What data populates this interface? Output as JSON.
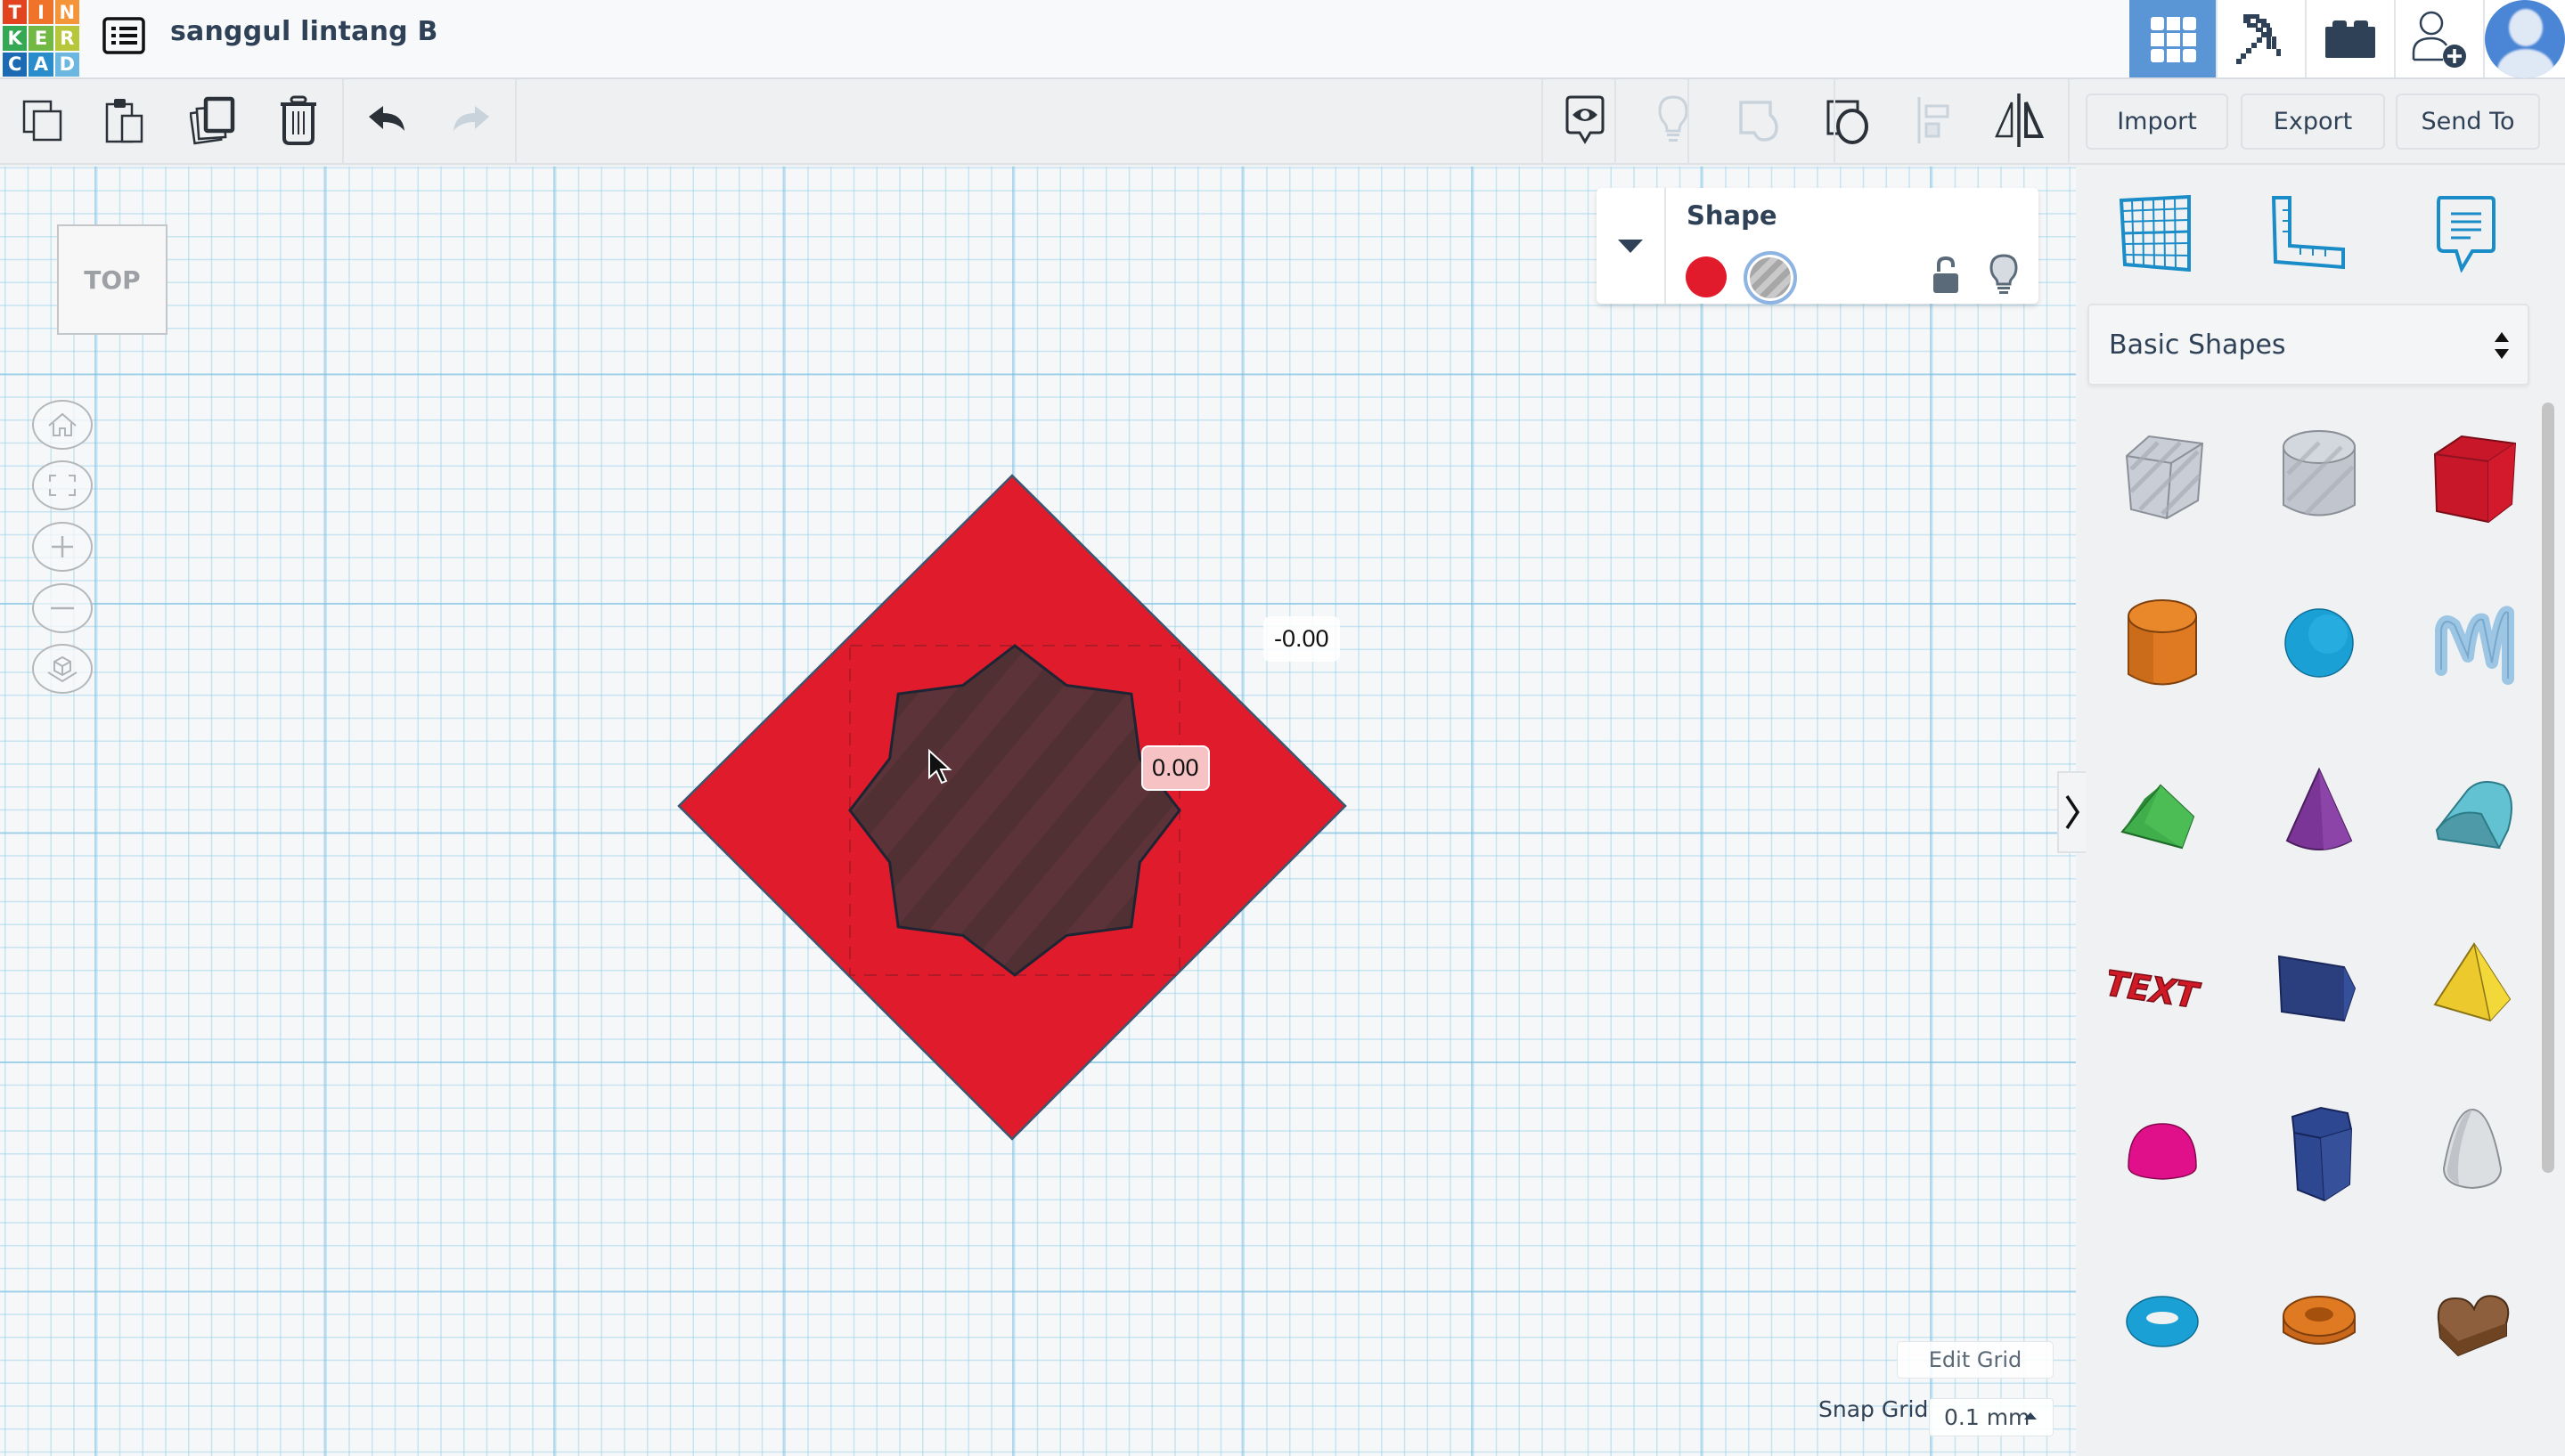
{
  "app": {
    "logo_letters": [
      "T",
      "I",
      "N",
      "K",
      "E",
      "R",
      "C",
      "A",
      "D"
    ],
    "logo_colors": [
      "#e1441f",
      "#f0732a",
      "#f5953a",
      "#34a853",
      "#72b844",
      "#b7c63a",
      "#1b6ab3",
      "#2a8ccb",
      "#6bb7e0"
    ],
    "design_title": "sanggul lintang B"
  },
  "topnav": {
    "items": [
      {
        "name": "3d-design-view",
        "icon": "grid-icon",
        "active": true
      },
      {
        "name": "blocks-view",
        "icon": "pickaxe-icon",
        "active": false
      },
      {
        "name": "bricks-view",
        "icon": "brick-icon",
        "active": false
      },
      {
        "name": "invite-user",
        "icon": "user-add-icon",
        "active": false
      },
      {
        "name": "profile",
        "icon": "avatar-icon",
        "active": false
      }
    ]
  },
  "toolbar": {
    "left": [
      {
        "name": "copy",
        "icon": "copy-icon",
        "enabled": true
      },
      {
        "name": "paste",
        "icon": "paste-icon",
        "enabled": true
      },
      {
        "name": "duplicate",
        "icon": "duplicate-icon",
        "enabled": true
      },
      {
        "name": "delete",
        "icon": "trash-icon",
        "enabled": true
      },
      {
        "name": "undo",
        "icon": "undo-icon",
        "enabled": true
      },
      {
        "name": "redo",
        "icon": "redo-icon",
        "enabled": false
      }
    ],
    "right": [
      {
        "name": "notes",
        "icon": "eye-bubble-icon",
        "enabled": true
      },
      {
        "name": "show-all",
        "icon": "lightbulb-icon",
        "enabled": false
      },
      {
        "name": "group",
        "icon": "group-icon",
        "enabled": false
      },
      {
        "name": "ungroup",
        "icon": "ungroup-icon",
        "enabled": true
      },
      {
        "name": "align",
        "icon": "align-icon",
        "enabled": false
      },
      {
        "name": "mirror",
        "icon": "mirror-icon",
        "enabled": true
      }
    ],
    "import_label": "Import",
    "export_label": "Export",
    "send_to_label": "Send To"
  },
  "viewport": {
    "view_cube_label": "TOP",
    "nav_controls": [
      {
        "name": "home-view",
        "icon": "home-icon"
      },
      {
        "name": "fit-view",
        "icon": "fit-icon"
      },
      {
        "name": "zoom-in",
        "icon": "plus-icon"
      },
      {
        "name": "zoom-out",
        "icon": "minus-icon"
      },
      {
        "name": "perspective",
        "icon": "cube-icon"
      }
    ],
    "dimension_labels": {
      "outer": "-0.00",
      "inner": "0.00"
    },
    "edit_grid_label": "Edit Grid",
    "snap_grid_label": "Snap Grid",
    "snap_grid_value": "0.1 mm"
  },
  "inspector": {
    "title": "Shape",
    "solid_color": "#e11b2c",
    "hole_selected": true
  },
  "scene": {
    "diamond_color": "#e01b2c",
    "star_color": "#5a3236",
    "outline_color": "#3d5670"
  },
  "library": {
    "tabs": [
      {
        "name": "workplane",
        "icon": "workplane-grid-icon"
      },
      {
        "name": "ruler",
        "icon": "ruler-icon"
      },
      {
        "name": "notes",
        "icon": "note-bubble-icon"
      }
    ],
    "category": "Basic Shapes",
    "shapes": [
      {
        "name": "box-hole",
        "color": "#c5cad2"
      },
      {
        "name": "cylinder-hole",
        "color": "#c5cad2"
      },
      {
        "name": "box",
        "color": "#c9172a"
      },
      {
        "name": "cylinder",
        "color": "#e07a22"
      },
      {
        "name": "sphere",
        "color": "#1aa0d4"
      },
      {
        "name": "scribble",
        "color": "#9cc6e4"
      },
      {
        "name": "roof",
        "color": "#3fae4b"
      },
      {
        "name": "cone",
        "color": "#7b3596"
      },
      {
        "name": "round-roof",
        "color": "#62c2d2"
      },
      {
        "name": "text",
        "color": "#d01b27"
      },
      {
        "name": "wedge",
        "color": "#2b3f7e"
      },
      {
        "name": "pyramid",
        "color": "#ecc92c"
      },
      {
        "name": "half-sphere",
        "color": "#e0108a"
      },
      {
        "name": "polygon",
        "color": "#2d4790"
      },
      {
        "name": "paraboloid",
        "color": "#dcdfe2"
      },
      {
        "name": "torus",
        "color": "#1aa0d4"
      },
      {
        "name": "tube",
        "color": "#e07a22"
      },
      {
        "name": "heart",
        "color": "#8d5f3c"
      }
    ]
  }
}
